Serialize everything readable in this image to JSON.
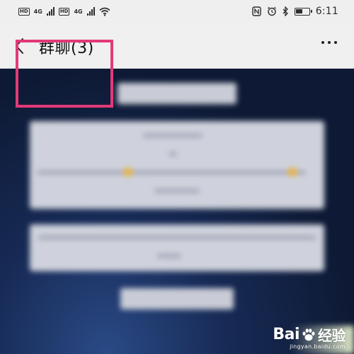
{
  "status_bar": {
    "sim1_badge": "HD",
    "sim1_net": "4G",
    "sim2_badge": "HD",
    "sim2_net": "4G",
    "battery_level": 0.5,
    "time": "6:11",
    "icons": [
      "wifi-icon",
      "nfc-icon",
      "alarm-icon",
      "bluetooth-icon",
      "battery-icon"
    ]
  },
  "header": {
    "title": "群聊(3)",
    "back_icon": "chevron-left-icon",
    "more_icon": "more-dots-icon"
  },
  "annotation": {
    "color": "#e23a78"
  },
  "watermark": {
    "brand_text": "Bai",
    "brand_suffix": "经验",
    "url": "jingyan.baidu.com"
  },
  "colors": {
    "titlebar_bg": "#f0f0f0",
    "chat_bg": "#0f1a33",
    "highlight_box": "#e23a78"
  }
}
